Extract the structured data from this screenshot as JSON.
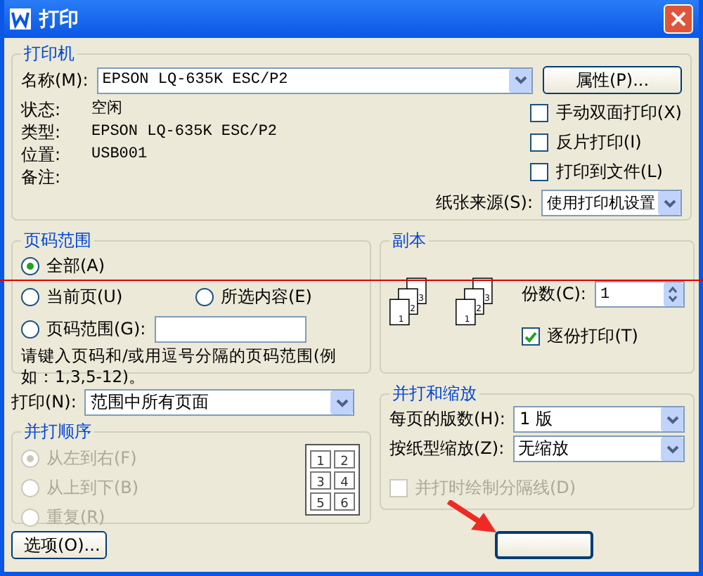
{
  "window": {
    "title": "打印"
  },
  "printer": {
    "title": "打印机",
    "name_label": "名称(M):",
    "name_value": "EPSON LQ-635K ESC/P2",
    "properties_button": "属性(P)...",
    "info": [
      {
        "label": "状态:",
        "value": "空闲"
      },
      {
        "label": "类型:",
        "value": "EPSON LQ-635K ESC/P2"
      },
      {
        "label": "位置:",
        "value": "USB001"
      },
      {
        "label": "备注:"
      }
    ],
    "options": [
      {
        "label": "手动双面打印(X)",
        "checked": false
      },
      {
        "label": "反片打印(I)",
        "checked": false
      },
      {
        "label": "打印到文件(L)",
        "checked": false
      }
    ],
    "paper_source": {
      "label": "纸张来源(S):",
      "value": "使用打印机设置"
    }
  },
  "page_range": {
    "title": "页码范围",
    "options": [
      {
        "label": "全部(A)",
        "selected": true
      },
      {
        "label": "当前页(U)",
        "selected": false
      },
      {
        "label": "所选内容(E)",
        "selected": false
      },
      {
        "label": "页码范围(G):",
        "selected": false
      }
    ],
    "hint": "请键入页码和/或用逗号分隔的页码范围(例如：1,3,5-12)。"
  },
  "copies": {
    "title": "副本",
    "count_label": "份数(C):",
    "count_value": "1",
    "collate_preview": [
      [
        "1",
        "2",
        "3"
      ],
      [
        "1",
        "2",
        "3"
      ]
    ],
    "collate": {
      "label": "逐份打印(T)",
      "checked": true
    }
  },
  "print_what": {
    "label": "打印(N):",
    "value": "范围中所有页面"
  },
  "order": {
    "title": "并打顺序",
    "disabled": true,
    "options": [
      {
        "label": "从左到右(F)",
        "selected": true
      },
      {
        "label": "从上到下(B)",
        "selected": false
      },
      {
        "label": "重复(R)",
        "selected": false
      }
    ],
    "preview_pages": [
      "1",
      "2",
      "3",
      "4",
      "5",
      "6"
    ]
  },
  "scaling": {
    "title": "并打和缩放",
    "pages_per_sheet": {
      "label": "每页的版数(H):",
      "value": "1 版"
    },
    "scale": {
      "label": "按纸型缩放(Z):",
      "value": "无缩放"
    },
    "draw_borders": {
      "label": "并打时绘制分隔线(D)",
      "checked": false,
      "disabled": true
    }
  },
  "buttons": {
    "options": "选项(O)..."
  },
  "markup": {
    "line": true,
    "arrow": true
  }
}
